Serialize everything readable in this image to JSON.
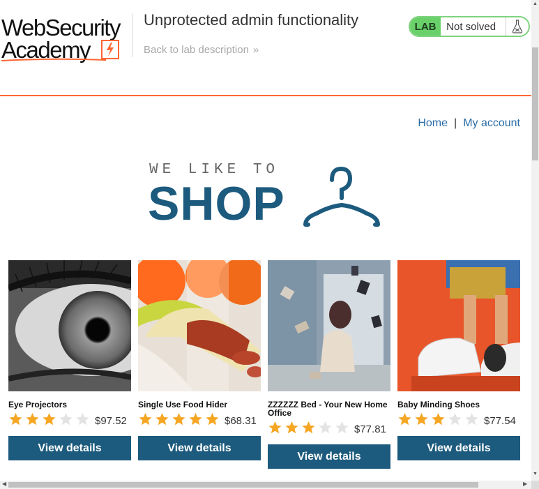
{
  "header": {
    "logo_line1": "WebSecurity",
    "logo_line2": "Academy",
    "lab_title": "Unprotected admin functionality",
    "back_link": "Back to lab description",
    "back_chevrons": "»",
    "lab_badge": "LAB",
    "lab_status": "Not solved"
  },
  "nav": {
    "home": "Home",
    "separator": "|",
    "my_account": "My account"
  },
  "banner": {
    "tagline": "WE LIKE TO",
    "headline": "SHOP"
  },
  "colors": {
    "accent_orange": "#ff6633",
    "brand_blue": "#1d5b7e",
    "link_blue": "#2a6ca5",
    "star_gold": "#f5a623",
    "star_empty": "#e3e3e3",
    "lab_green": "#6ad06a"
  },
  "products": [
    {
      "name": "Eye Projectors",
      "rating": 3,
      "max_rating": 5,
      "price": "$97.52",
      "button": "View details",
      "image": "eye-closeup-photo"
    },
    {
      "name": "Single Use Food Hider",
      "rating": 5,
      "max_rating": 5,
      "price": "$68.31",
      "button": "View details",
      "image": "sausage-banana-photo"
    },
    {
      "name": "ZZZZZZ Bed - Your New Home Office",
      "rating": 3,
      "max_rating": 5,
      "price": "$77.81",
      "button": "View details",
      "image": "bedroom-books-photo"
    },
    {
      "name": "Baby Minding Shoes",
      "rating": 3,
      "max_rating": 5,
      "price": "$77.54",
      "button": "View details",
      "image": "toy-shoes-photo"
    }
  ],
  "icons": {
    "flask": "flask-icon",
    "hanger": "hanger-icon",
    "star": "star-icon"
  }
}
